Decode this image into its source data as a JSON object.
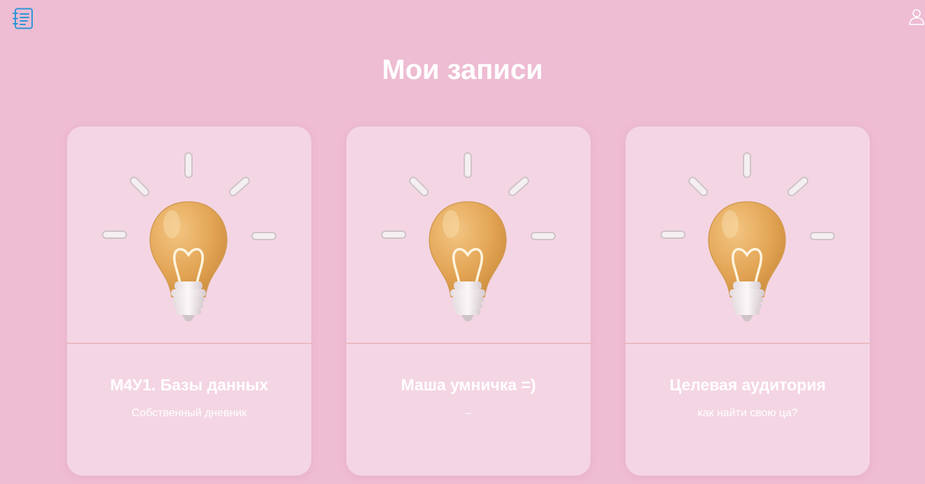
{
  "header": {
    "logo_icon": "notebook-list-icon",
    "user_icon": "user-profile-icon"
  },
  "page": {
    "title": "Мои записи"
  },
  "cards": [
    {
      "title": "М4У1. Базы данных",
      "subtitle": "Собственный дневник",
      "image": "lightbulb-illustration"
    },
    {
      "title": "Маша умничка =)",
      "subtitle": "–",
      "image": "lightbulb-illustration"
    },
    {
      "title": "Целевая аудитория",
      "subtitle": "как найти свою ца?",
      "image": "lightbulb-illustration"
    }
  ],
  "colors": {
    "background": "#eebcd3",
    "card": "#f4d5e4",
    "divider": "#e4a7a9",
    "logo": "#2f96d6",
    "bulb": "#e2a454"
  }
}
